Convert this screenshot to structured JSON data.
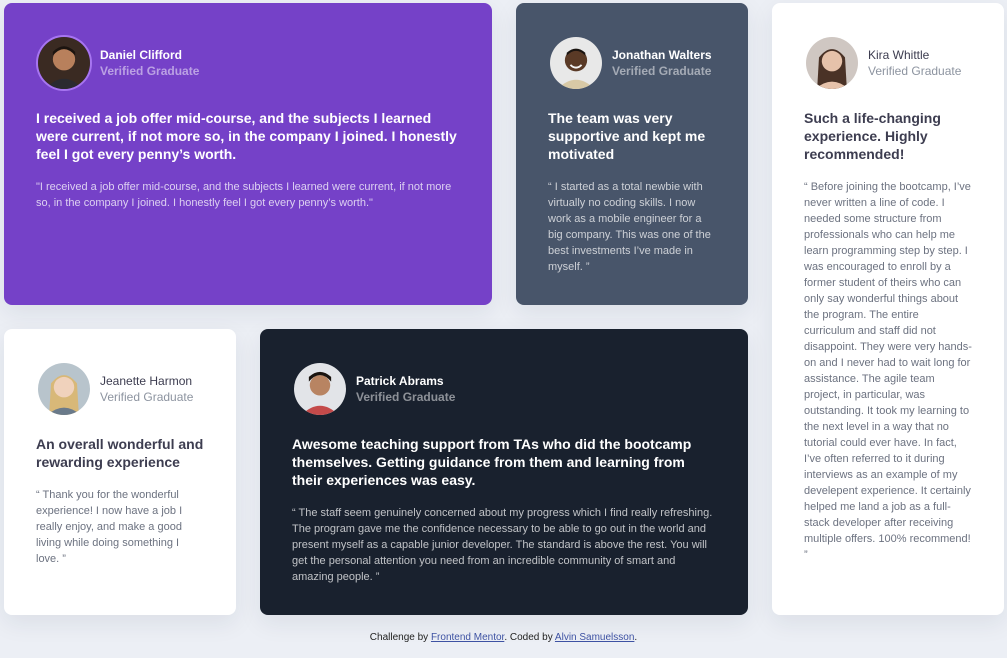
{
  "colors": {
    "page_background": "#eceff5",
    "purple_card": "#7541c8",
    "grey_card": "#48556a",
    "white_card": "#ffffff",
    "dark_card": "#19212e",
    "link": "#3e52a3"
  },
  "testimonials": [
    {
      "name": "Daniel Clifford",
      "role": "Verified Graduate",
      "headline": "I received a job offer mid-course, and the subjects I learned were current, if not more so, in the company I joined. I honestly feel I got every penny’s worth.",
      "quote": "\"I received a job offer mid-course, and the subjects I learned were current, if not more so, in the company I joined. I honestly feel I got every penny’s worth.\"",
      "avatar_icon": "avatar-photo-daniel"
    },
    {
      "name": "Jonathan Walters",
      "role": "Verified Graduate",
      "headline": "The team was very supportive and kept me motivated",
      "quote": "“ I started as a total newbie with virtually no coding skills. I now work as a mobile engineer for a big company. This was one of the best investments I’ve made in myself. ”",
      "avatar_icon": "avatar-photo-jonathan"
    },
    {
      "name": "Kira Whittle",
      "role": "Verified Graduate",
      "headline": "Such a life-changing experience. Highly recommended!",
      "quote": "“ Before joining the bootcamp, I’ve never written a line of code. I needed some structure from professionals who can help me learn programming step by step. I was encouraged to enroll by a former student of theirs who can only say wonderful things about the program. The entire curriculum and staff did not disappoint. They were very hands-on and I never had to wait long for assistance. The agile team project, in particular, was outstanding. It took my learning to the next level in a way that no tutorial could ever have. In fact, I’ve often referred to it during interviews as an example of my develepent experience. It certainly helped me land a job as a full-stack developer after receiving multiple offers. 100% recommend! ”",
      "avatar_icon": "avatar-photo-kira"
    },
    {
      "name": "Jeanette Harmon",
      "role": "Verified Graduate",
      "headline": "An overall wonderful and rewarding experience",
      "quote": "“ Thank you for the wonderful experience! I now have a job I really enjoy, and make a good living while doing something I love. ”",
      "avatar_icon": "avatar-photo-jeanette"
    },
    {
      "name": "Patrick Abrams",
      "role": "Verified Graduate",
      "headline": "Awesome teaching support from TAs who did the bootcamp themselves. Getting guidance from them and learning from their experiences was easy.",
      "quote": "“ The staff seem genuinely concerned about my progress which I find really refreshing. The program gave me the confidence necessary to be able to go out in the world and present myself as a capable junior developer. The standard is above the rest. You will get the personal attention you need from an incredible community of smart and amazing people. ”",
      "avatar_icon": "avatar-photo-patrick"
    }
  ],
  "attribution": {
    "prefix": "Challenge by ",
    "link1": "Frontend Mentor",
    "middle": ". Coded by ",
    "link2": "Alvin Samuelsson",
    "suffix": "."
  }
}
